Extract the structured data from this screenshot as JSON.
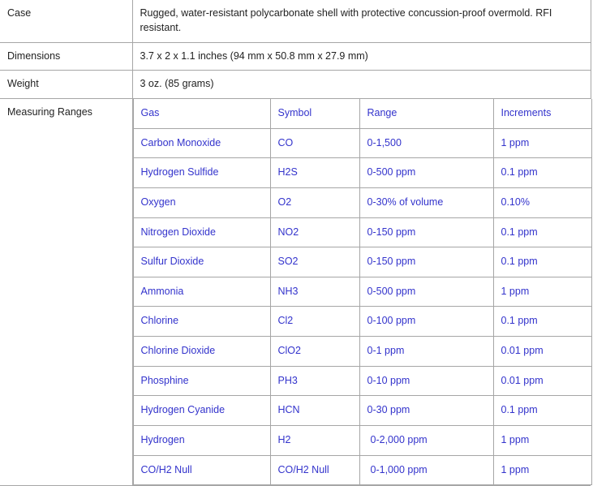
{
  "colors": {
    "link_blue": "#3333cc",
    "border_gray": "#a6a6a6",
    "text_dark": "#1f1f1f",
    "background": "#ffffff"
  },
  "spec_table": {
    "rows": [
      {
        "label": "Case",
        "value": "Rugged, water-resistant polycarbonate shell with protective concussion-proof overmold. RFI resistant."
      },
      {
        "label": "Dimensions",
        "value": "3.7 x 2 x 1.1 inches (94 mm x 50.8 mm x 27.9 mm)"
      },
      {
        "label": "Weight",
        "value": "3 oz. (85 grams)"
      },
      {
        "label": "Measuring Ranges",
        "value": ""
      }
    ]
  },
  "gas_table": {
    "headers": [
      "Gas",
      "Symbol",
      "Range",
      "Increments"
    ],
    "rows": [
      {
        "gas": "Carbon Monoxide",
        "symbol": "CO",
        "range": "0-1,500",
        "increments": "1 ppm"
      },
      {
        "gas": "Hydrogen Sulfide",
        "symbol": "H2S",
        "range": "0-500 ppm",
        "increments": "0.1 ppm"
      },
      {
        "gas": "Oxygen",
        "symbol": "O2",
        "range": "0-30% of volume",
        "increments": "0.10%"
      },
      {
        "gas": "Nitrogen Dioxide",
        "symbol": "NO2",
        "range": "0-150 ppm",
        "increments": "0.1 ppm"
      },
      {
        "gas": "Sulfur Dioxide",
        "symbol": "SO2",
        "range": "0-150 ppm",
        "increments": "0.1 ppm"
      },
      {
        "gas": "Ammonia",
        "symbol": "NH3",
        "range": "0-500 ppm",
        "increments": "1 ppm"
      },
      {
        "gas": "Chlorine",
        "symbol": "Cl2",
        "range": "0-100 ppm",
        "increments": "0.1 ppm"
      },
      {
        "gas": "Chlorine Dioxide",
        "symbol": "ClO2",
        "range": "0-1 ppm",
        "increments": "0.01 ppm"
      },
      {
        "gas": "Phosphine",
        "symbol": "PH3",
        "range": "0-10 ppm",
        "increments": "0.01 ppm"
      },
      {
        "gas": "Hydrogen Cyanide",
        "symbol": "HCN",
        "range": "0-30 ppm",
        "increments": "0.1 ppm"
      },
      {
        "gas": "Hydrogen",
        "symbol": "H2",
        "range": "0-2,000 ppm",
        "increments": "1 ppm"
      },
      {
        "gas": "CO/H2 Null",
        "symbol": "CO/H2 Null",
        "range": "0-1,000 ppm",
        "increments": "1 ppm"
      }
    ]
  }
}
